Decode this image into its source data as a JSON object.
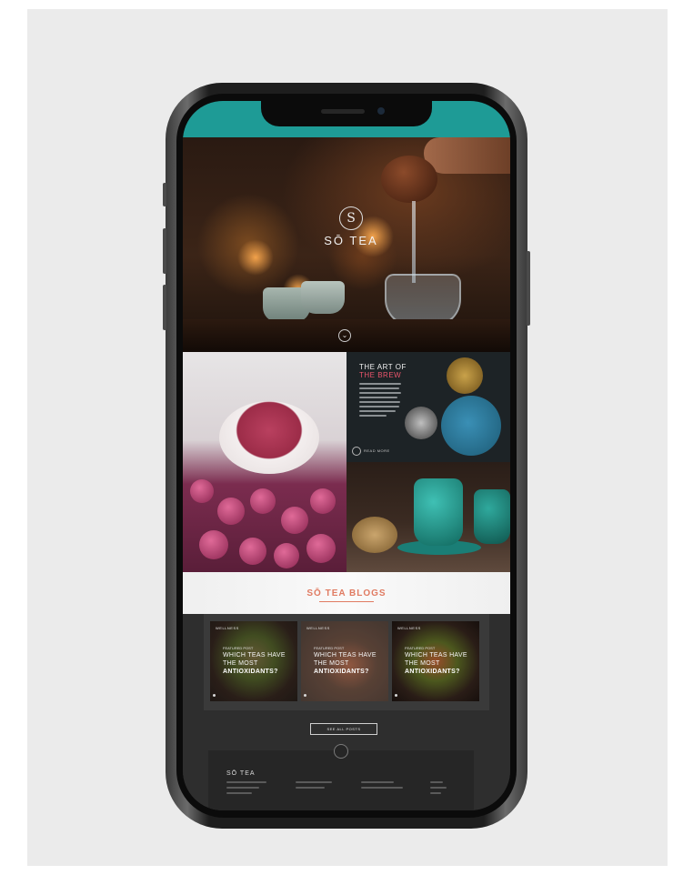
{
  "hero": {
    "logo_mark": "S",
    "brand_name": "SŌ TEA",
    "tagline": "",
    "scroll_icon": "chevron-down-icon",
    "scroll_glyph": "⌄"
  },
  "art_of_brew": {
    "title_line1": "THE ART OF",
    "title_line2": "THE BREW",
    "link_label": "READ MORE",
    "accent_color": "#e9546b"
  },
  "blogs": {
    "heading": "SŌ TEA BLOGS",
    "accent_color": "#e07b62",
    "posts": [
      {
        "category": "WELLNESS",
        "kicker": "FEATURED POST",
        "title_line1": "WHICH TEAS HAVE",
        "title_line2": "THE MOST",
        "title_line3": "ANTIOXIDANTS?"
      },
      {
        "category": "WELLNESS",
        "kicker": "FEATURED POST",
        "title_line1": "WHICH TEAS HAVE",
        "title_line2": "THE MOST",
        "title_line3": "ANTIOXIDANTS?"
      },
      {
        "category": "WELLNESS",
        "kicker": "FEATURED POST",
        "title_line1": "WHICH TEAS HAVE",
        "title_line2": "THE MOST",
        "title_line3": "ANTIOXIDANTS?"
      }
    ],
    "see_all_label": "SEE ALL POSTS"
  },
  "footer": {
    "brand": "SŌ TEA"
  },
  "status_bar_color": "#1e9b96"
}
